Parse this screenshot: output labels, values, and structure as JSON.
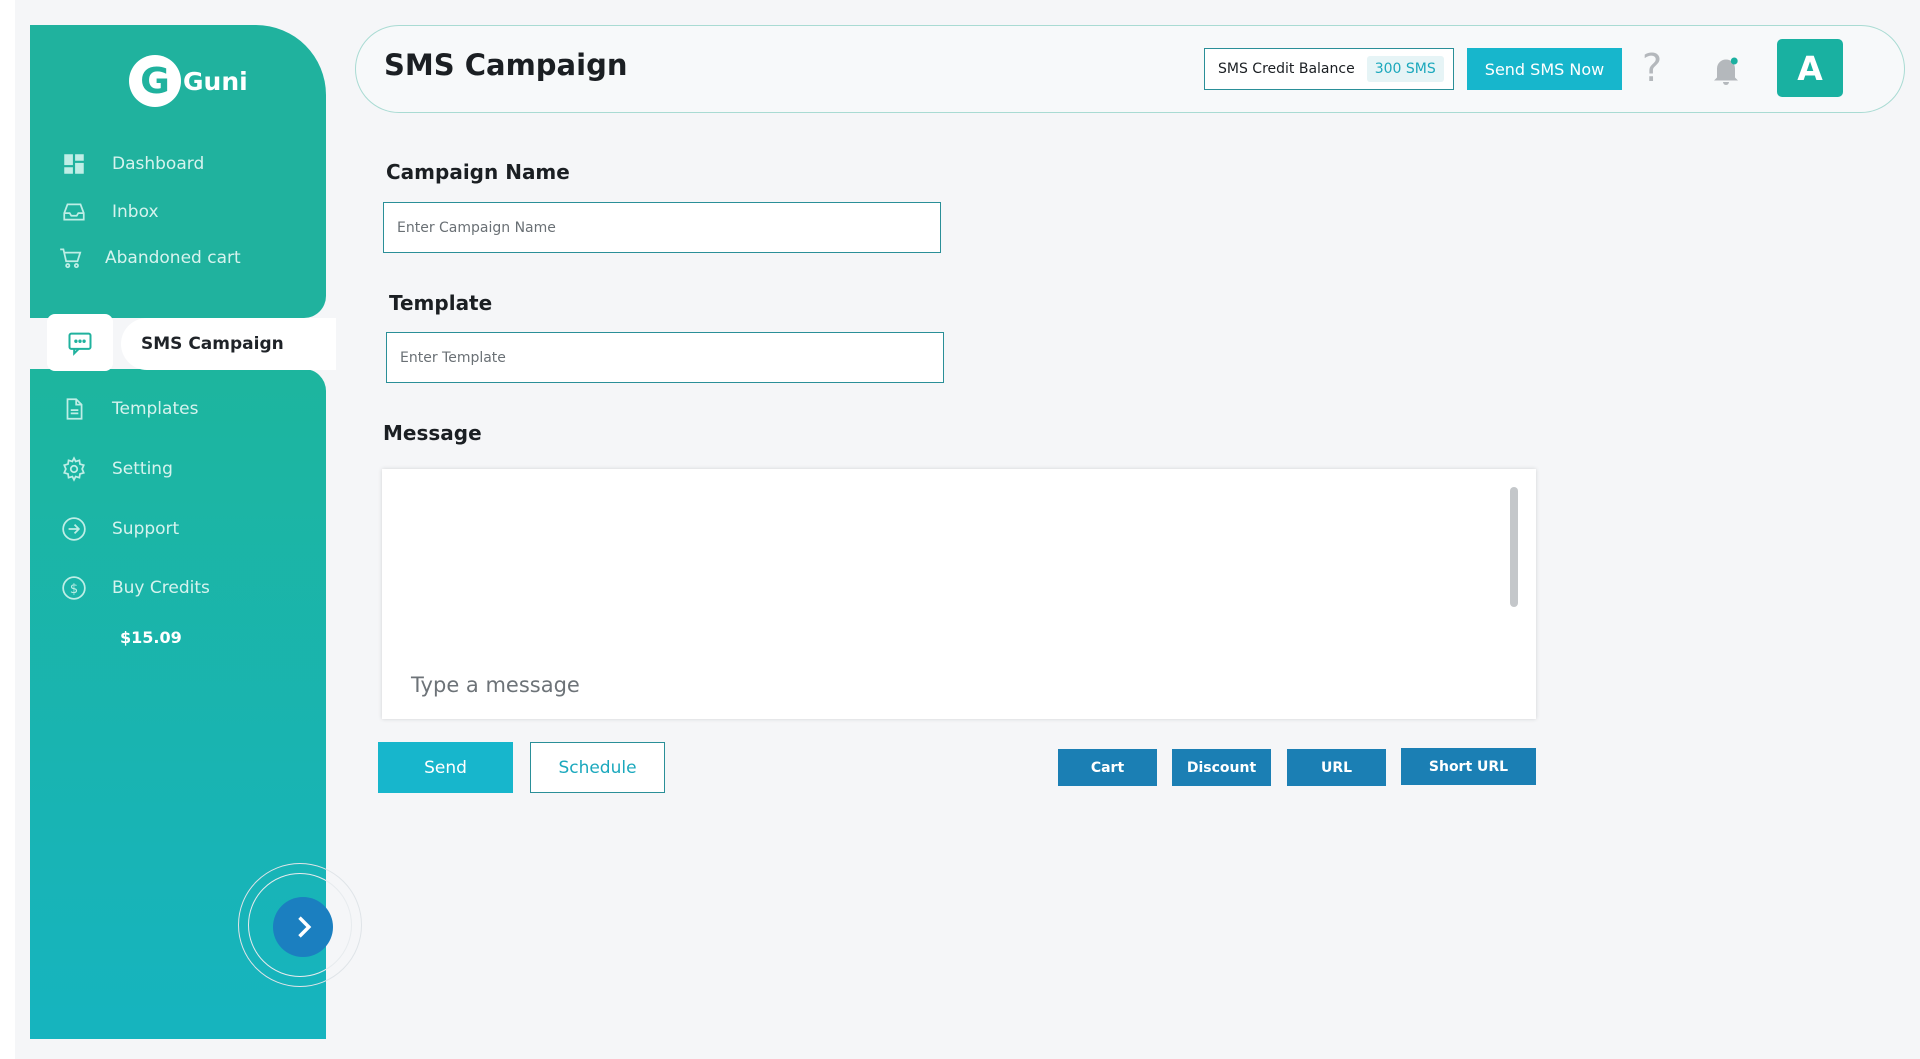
{
  "app": {
    "logo_letter": "G",
    "logo_text": "Guni",
    "brand_color": "#20b29e"
  },
  "sidebar": {
    "items": [
      {
        "label": "Dashboard",
        "icon": "dashboard-icon"
      },
      {
        "label": "Inbox",
        "icon": "inbox-icon"
      },
      {
        "label": "Abandoned cart",
        "icon": "cart-icon"
      },
      {
        "label": "SMS Campaign",
        "icon": "sms-icon",
        "active": true
      },
      {
        "label": "Templates",
        "icon": "document-icon"
      },
      {
        "label": "Setting",
        "icon": "gear-icon"
      },
      {
        "label": "Support",
        "icon": "arrow-circle-icon"
      },
      {
        "label": "Buy Credits",
        "icon": "dollar-icon"
      }
    ],
    "balance": "$15.09"
  },
  "header": {
    "title": "SMS Campaign",
    "credit_label": "SMS Credit Balance",
    "credit_value": "300 SMS",
    "send_now_label": "Send SMS Now",
    "help_symbol": "?",
    "avatar_letter": "A"
  },
  "form": {
    "campaign_label": "Campaign Name",
    "campaign_placeholder": "Enter Campaign Name",
    "template_label": "Template",
    "template_placeholder": "Enter Template",
    "message_label": "Message",
    "message_placeholder": "Type a message"
  },
  "actions": {
    "send": "Send",
    "schedule": "Schedule"
  },
  "chips": [
    "Cart",
    "Discount",
    "URL",
    "Short URL"
  ]
}
